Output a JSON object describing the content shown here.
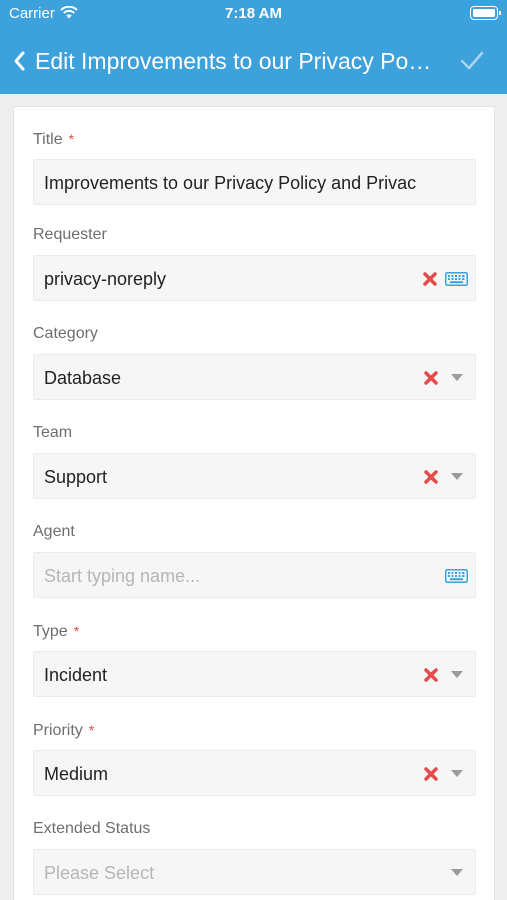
{
  "status_bar": {
    "carrier": "Carrier",
    "time": "7:18 AM"
  },
  "nav": {
    "title": "Edit Improvements to our Privacy Policy and Privacy Terms"
  },
  "form": {
    "title": {
      "label": "Title",
      "required": "*",
      "value": "Improvements to our Privacy Policy and Privac"
    },
    "requester": {
      "label": "Requester",
      "value": "privacy-noreply"
    },
    "category": {
      "label": "Category",
      "value": "Database"
    },
    "team": {
      "label": "Team",
      "value": "Support"
    },
    "agent": {
      "label": "Agent",
      "placeholder": "Start typing name..."
    },
    "type": {
      "label": "Type",
      "required": "*",
      "value": "Incident"
    },
    "priority": {
      "label": "Priority",
      "required": "*",
      "value": "Medium"
    },
    "extended_status": {
      "label": "Extended Status",
      "placeholder": "Please Select"
    }
  },
  "icons": {
    "back": "chevron-left-icon",
    "save": "checkmark-icon",
    "clear": "x-icon",
    "dropdown": "caret-down-icon",
    "keyboard": "keyboard-icon",
    "wifi": "wifi-icon",
    "battery": "battery-icon"
  },
  "colors": {
    "header": "#3da1db",
    "required": "#e24c4b",
    "clear": "#e24c4b",
    "keyboard": "#3da1db"
  }
}
